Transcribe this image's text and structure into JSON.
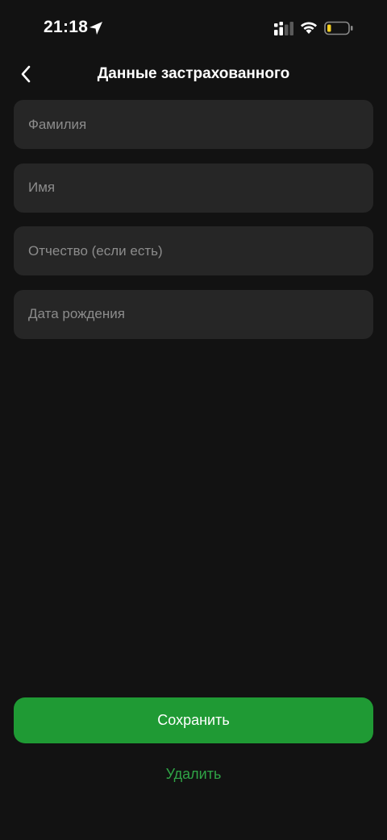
{
  "status_bar": {
    "time": "21:18",
    "icons": [
      "location-arrow-icon",
      "signal-icon",
      "wifi-icon",
      "battery-low-icon"
    ],
    "battery_color": "#f5d020"
  },
  "nav": {
    "back_icon": "chevron-left-icon",
    "title": "Данные застрахованного"
  },
  "form": {
    "fields": [
      {
        "placeholder": "Фамилия",
        "value": ""
      },
      {
        "placeholder": "Имя",
        "value": ""
      },
      {
        "placeholder": "Отчество (если есть)",
        "value": ""
      },
      {
        "placeholder": "Дата рождения",
        "value": ""
      }
    ]
  },
  "actions": {
    "save_label": "Сохранить",
    "delete_label": "Удалить"
  },
  "colors": {
    "background": "#121212",
    "field_background": "#262626",
    "accent": "#1f9a34",
    "accent_text": "#2fa446"
  }
}
